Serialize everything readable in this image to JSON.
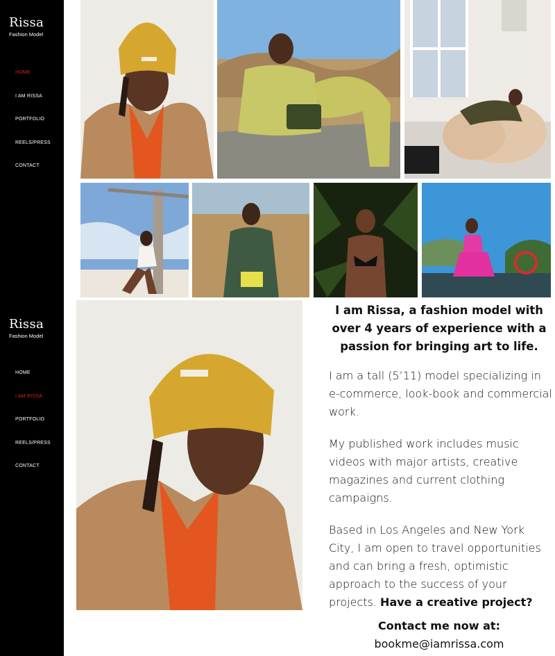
{
  "brand": {
    "name": "Rissa",
    "tagline": "Fashion Model"
  },
  "nav_top": [
    {
      "label": "HOME",
      "active": true
    },
    {
      "label": "I AM RISSA",
      "active": false
    },
    {
      "label": "PORTFOLIO",
      "active": false
    },
    {
      "label": "REELS/PRESS",
      "active": false
    },
    {
      "label": "CONTACT",
      "active": false
    }
  ],
  "nav_bottom": [
    {
      "label": "HOME",
      "active": false
    },
    {
      "label": "I AM RISSA",
      "active": true
    },
    {
      "label": "PORTFOLIO",
      "active": false
    },
    {
      "label": "REELS/PRESS",
      "active": false
    },
    {
      "label": "CONTACT",
      "active": false
    }
  ],
  "about": {
    "headline": "I am Rissa, a fashion model with over 4 years of experience with a passion for bringing art to life.",
    "para1": "I am a tall (5’11) model specializing in e-commerce, look-book and commercial work.",
    "para2": "My published work includes music videos with major artists, creative magazines and current clothing campaigns.",
    "para3": "Based in Los Angeles and New York City, I am open to travel opportunities and can bring a fresh, optimistic approach to the success of your projects.",
    "para3_cta": "Have a creative project?",
    "contact_label": "Contact me now at:",
    "email": "bookme@iamrissa.com"
  },
  "colors": {
    "sidebar_bg": "#000000",
    "active_nav": "#d9261c",
    "text": "#111111"
  }
}
